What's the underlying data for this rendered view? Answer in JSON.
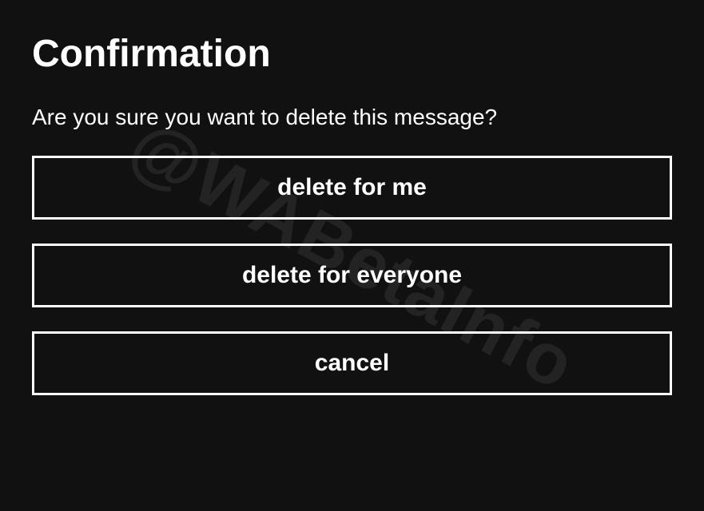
{
  "dialog": {
    "title": "Confirmation",
    "message": "Are you sure you want to delete this message?",
    "buttons": {
      "delete_for_me": "delete for me",
      "delete_for_everyone": "delete for everyone",
      "cancel": "cancel"
    }
  },
  "watermark": "@WABetaInfo"
}
